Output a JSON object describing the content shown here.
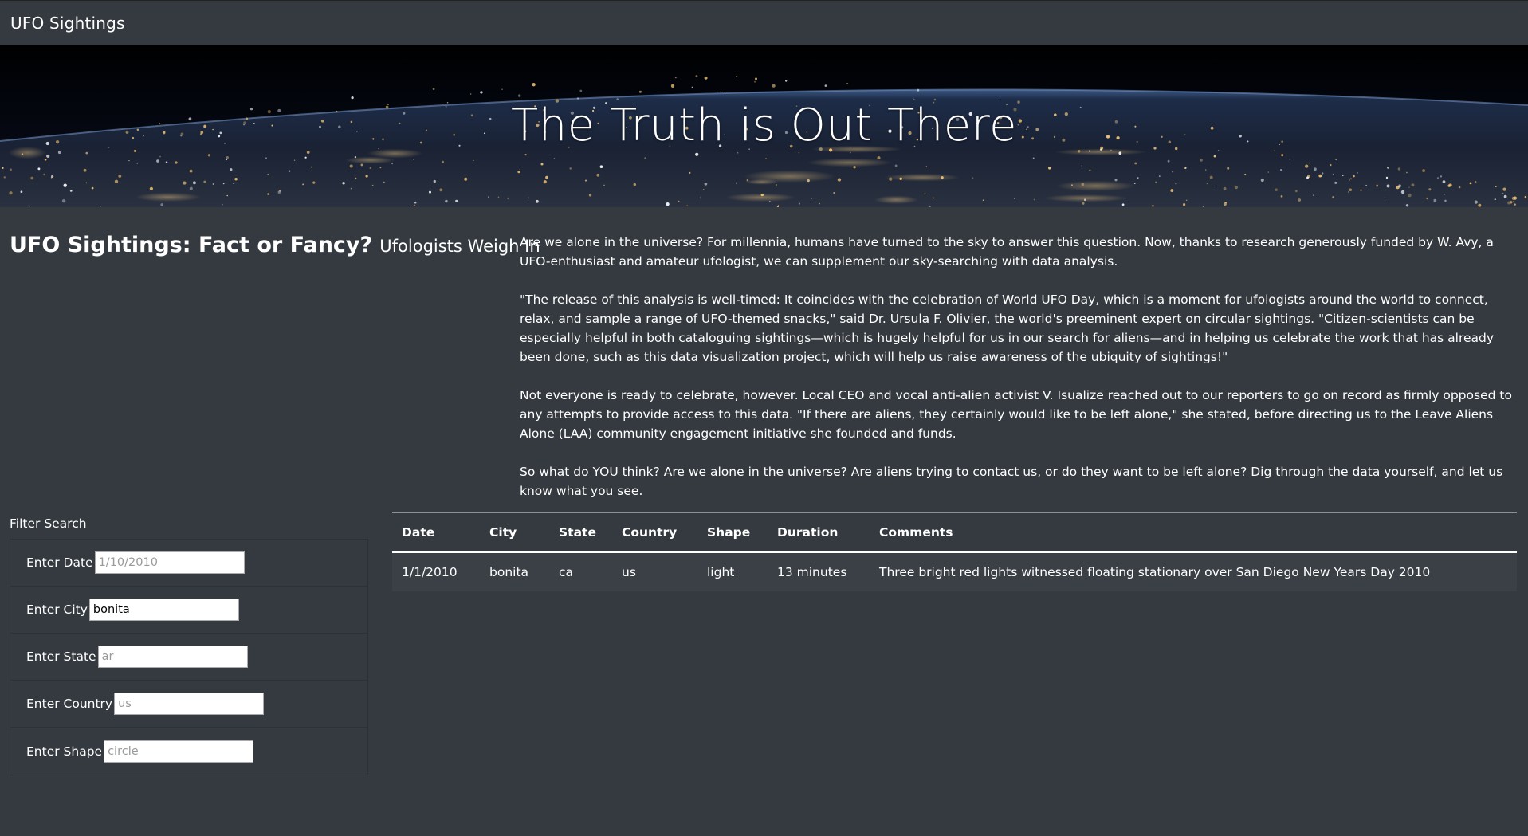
{
  "navbar": {
    "brand": "UFO Sightings"
  },
  "hero": {
    "title": "The Truth is Out There"
  },
  "article": {
    "heading": "UFO Sightings: Fact or Fancy?",
    "subheading": "Ufologists Weigh In",
    "paragraphs": [
      "Are we alone in the universe? For millennia, humans have turned to the sky to answer this question. Now, thanks to research generously funded by W. Avy, a UFO-enthusiast and amateur ufologist, we can supplement our sky-searching with data analysis.",
      "\"The release of this analysis is well-timed: It coincides with the celebration of World UFO Day, which is a moment for ufologists around the world to connect, relax, and sample a range of UFO-themed snacks,\" said Dr. Ursula F. Olivier, the world's preeminent expert on circular sightings. \"Citizen-scientists can be especially helpful in both cataloguing sightings—which is hugely helpful for us in our search for aliens—and in helping us celebrate the work that has already been done, such as this data visualization project, which will help us raise awareness of the ubiquity of sightings!\"",
      "Not everyone is ready to celebrate, however. Local CEO and vocal anti-alien activist V. Isualize reached out to our reporters to go on record as firmly opposed to any attempts to provide access to this data. \"If there are aliens, they certainly would like to be left alone,\" she stated, before directing us to the Leave Aliens Alone (LAA) community engagement initiative she founded and funds.",
      "So what do YOU think? Are we alone in the universe? Are aliens trying to contact us, or do they want to be left alone? Dig through the data yourself, and let us know what you see."
    ]
  },
  "filters": {
    "title": "Filter Search",
    "items": [
      {
        "label": "Enter Date",
        "value": "",
        "placeholder": "1/10/2010"
      },
      {
        "label": "Enter City",
        "value": "bonita",
        "placeholder": ""
      },
      {
        "label": "Enter State",
        "value": "",
        "placeholder": "ar"
      },
      {
        "label": "Enter Country",
        "value": "",
        "placeholder": "us"
      },
      {
        "label": "Enter Shape",
        "value": "",
        "placeholder": "circle"
      }
    ]
  },
  "table": {
    "headers": [
      "Date",
      "City",
      "State",
      "Country",
      "Shape",
      "Duration",
      "Comments"
    ],
    "rows": [
      [
        "1/1/2010",
        "bonita",
        "ca",
        "us",
        "light",
        "13 minutes",
        "Three bright red lights witnessed floating stationary over San Diego New Years Day 2010"
      ]
    ]
  }
}
